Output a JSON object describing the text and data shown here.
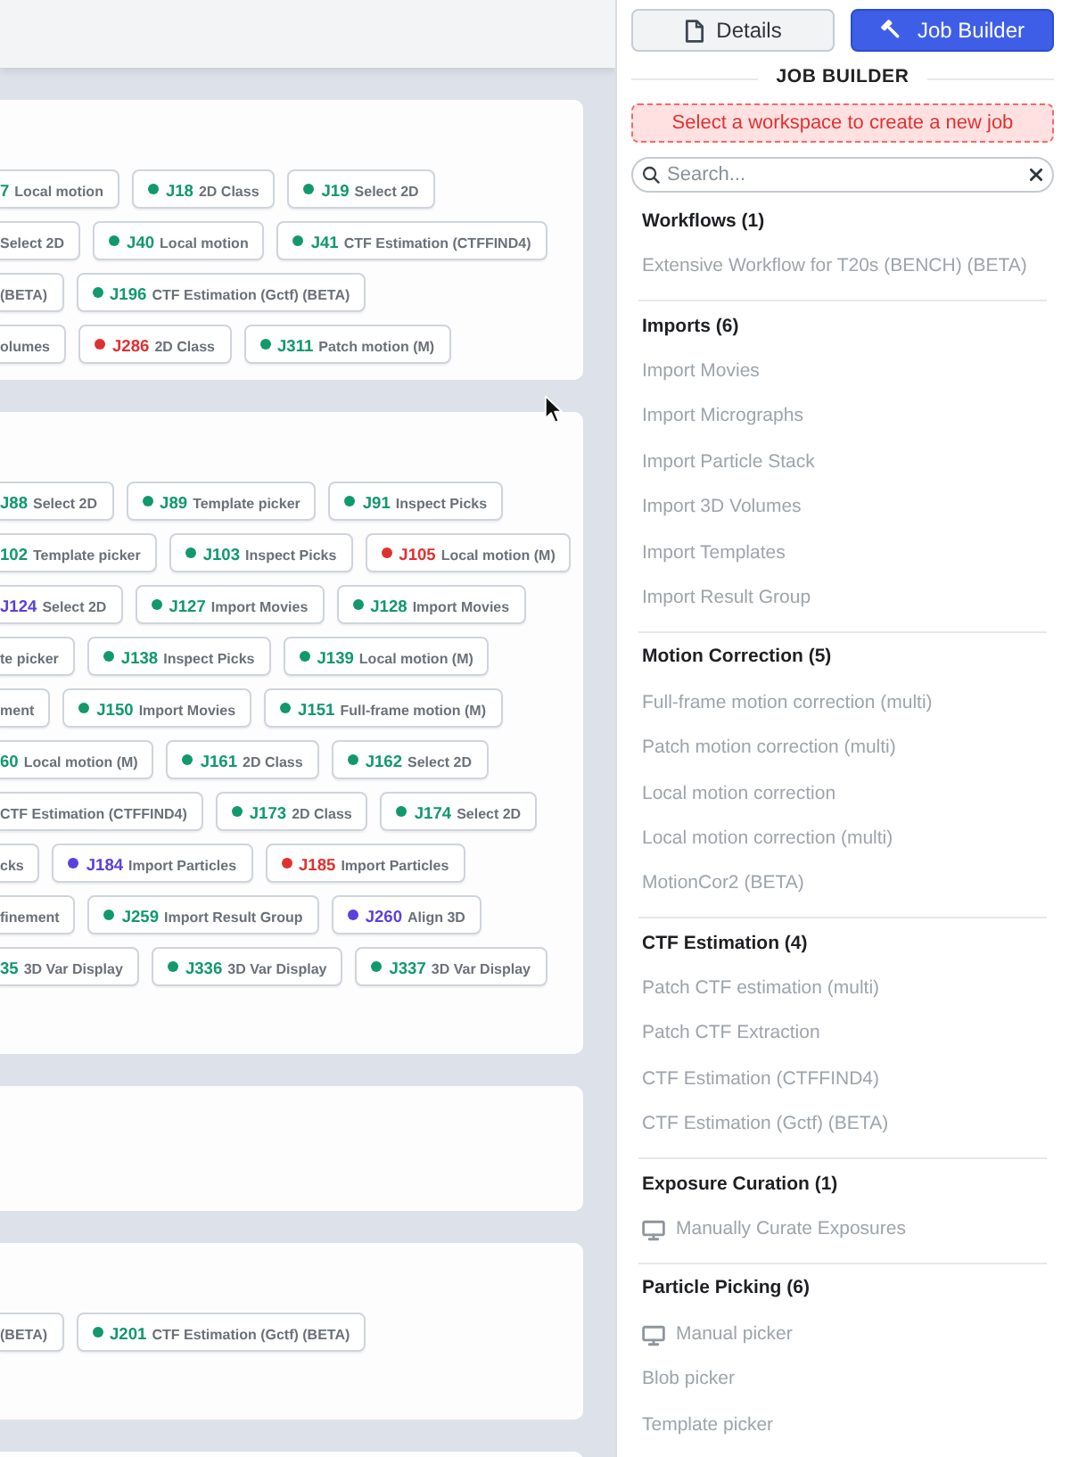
{
  "workspace_cards": [
    {
      "kind": "jobs",
      "rows": [
        [
          {
            "kind": "clipped",
            "job": "7",
            "title": "Local motion",
            "color": "#11996b"
          },
          {
            "kind": "full",
            "job": "J18",
            "title": "2D Class",
            "color": "#11996b"
          },
          {
            "kind": "full",
            "job": "J19",
            "title": "Select 2D",
            "color": "#11996b"
          }
        ],
        [
          {
            "kind": "clipped",
            "title": "Select 2D"
          },
          {
            "kind": "full",
            "job": "J40",
            "title": "Local motion",
            "color": "#11996b"
          },
          {
            "kind": "full",
            "job": "J41",
            "title": "CTF Estimation (CTFFIND4)",
            "color": "#11996b"
          }
        ],
        [
          {
            "kind": "clipped",
            "title": "(BETA)"
          },
          {
            "kind": "full",
            "job": "J196",
            "title": "CTF Estimation (Gctf) (BETA)",
            "color": "#11996b"
          }
        ],
        [
          {
            "kind": "clipped",
            "title": "olumes"
          },
          {
            "kind": "full",
            "job": "J286",
            "title": "2D Class",
            "color": "#e03131"
          },
          {
            "kind": "full",
            "job": "J311",
            "title": "Patch motion (M)",
            "color": "#11996b"
          }
        ]
      ]
    },
    {
      "kind": "jobs",
      "rows": [
        [
          {
            "kind": "clipped",
            "job": "J88",
            "title": "Select 2D",
            "color": "#11996b"
          },
          {
            "kind": "full",
            "job": "J89",
            "title": "Template picker",
            "color": "#11996b"
          },
          {
            "kind": "full",
            "job": "J91",
            "title": "Inspect Picks",
            "color": "#11996b"
          }
        ],
        [
          {
            "kind": "clipped",
            "job": "102",
            "title": "Template picker",
            "color": "#11996b"
          },
          {
            "kind": "full",
            "job": "J103",
            "title": "Inspect Picks",
            "color": "#11996b"
          },
          {
            "kind": "full",
            "job": "J105",
            "title": "Local motion (M)",
            "color": "#e03131"
          }
        ],
        [
          {
            "kind": "clipped",
            "job": "J124",
            "title": "Select 2D",
            "color": "#5b3fe0"
          },
          {
            "kind": "full",
            "job": "J127",
            "title": "Import Movies",
            "color": "#11996b"
          },
          {
            "kind": "full",
            "job": "J128",
            "title": "Import Movies",
            "color": "#11996b"
          }
        ],
        [
          {
            "kind": "clipped",
            "title": "te picker"
          },
          {
            "kind": "full",
            "job": "J138",
            "title": "Inspect Picks",
            "color": "#11996b"
          },
          {
            "kind": "full",
            "job": "J139",
            "title": "Local motion (M)",
            "color": "#11996b"
          }
        ],
        [
          {
            "kind": "clipped",
            "title": "ment"
          },
          {
            "kind": "full",
            "job": "J150",
            "title": "Import Movies",
            "color": "#11996b"
          },
          {
            "kind": "full",
            "job": "J151",
            "title": "Full-frame motion (M)",
            "color": "#11996b"
          }
        ],
        [
          {
            "kind": "clipped",
            "job": "60",
            "title": "Local motion (M)",
            "color": "#11996b"
          },
          {
            "kind": "full",
            "job": "J161",
            "title": "2D Class",
            "color": "#11996b"
          },
          {
            "kind": "full",
            "job": "J162",
            "title": "Select 2D",
            "color": "#11996b"
          }
        ],
        [
          {
            "kind": "clipped",
            "title": "CTF Estimation (CTFFIND4)"
          },
          {
            "kind": "full",
            "job": "J173",
            "title": "2D Class",
            "color": "#11996b"
          },
          {
            "kind": "full",
            "job": "J174",
            "title": "Select 2D",
            "color": "#11996b"
          }
        ],
        [
          {
            "kind": "clipped",
            "title": "cks"
          },
          {
            "kind": "full",
            "job": "J184",
            "title": "Import Particles",
            "color": "#5b3fe0"
          },
          {
            "kind": "full",
            "job": "J185",
            "title": "Import Particles",
            "color": "#e03131"
          }
        ],
        [
          {
            "kind": "clipped",
            "title": "finement"
          },
          {
            "kind": "full",
            "job": "J259",
            "title": "Import Result Group",
            "color": "#11996b"
          },
          {
            "kind": "full",
            "job": "J260",
            "title": "Align 3D",
            "color": "#5b3fe0"
          }
        ],
        [
          {
            "kind": "clipped",
            "job": "35",
            "title": "3D Var Display",
            "color": "#11996b"
          },
          {
            "kind": "full",
            "job": "J336",
            "title": "3D Var Display",
            "color": "#11996b"
          },
          {
            "kind": "full",
            "job": "J337",
            "title": "3D Var Display",
            "color": "#11996b"
          }
        ]
      ]
    },
    {
      "kind": "blank"
    },
    {
      "kind": "jobs",
      "rows": [
        [
          {
            "kind": "clipped",
            "title": "(BETA)"
          },
          {
            "kind": "full",
            "job": "J201",
            "title": "CTF Estimation (Gctf) (BETA)",
            "color": "#11996b"
          }
        ]
      ]
    },
    {
      "kind": "blank"
    }
  ],
  "tabs": [
    {
      "label": "Details",
      "selected": false
    },
    {
      "label": "Job Builder",
      "selected": true
    }
  ],
  "job_builder": {
    "title": "JOB BUILDER",
    "alert": "Select a workspace to create a new job",
    "search": {
      "placeholder": "Search..."
    },
    "categories": [
      {
        "heading": "Workflows (1)",
        "items": [
          {
            "label": "Extensive Workflow for T20s (BENCH) (BETA)",
            "kind": "standard",
            "disabled": true
          }
        ]
      },
      {
        "heading": "Imports (6)",
        "items": [
          {
            "label": "Import Movies",
            "kind": "standard",
            "disabled": true
          },
          {
            "label": "Import Micrographs",
            "kind": "standard",
            "disabled": true
          },
          {
            "label": "Import Particle Stack",
            "kind": "standard",
            "disabled": true
          },
          {
            "label": "Import 3D Volumes",
            "kind": "standard",
            "disabled": true
          },
          {
            "label": "Import Templates",
            "kind": "standard",
            "disabled": true
          },
          {
            "label": "Import Result Group",
            "kind": "standard",
            "disabled": true
          }
        ]
      },
      {
        "heading": "Motion Correction (5)",
        "items": [
          {
            "label": "Full-frame motion correction (multi)",
            "kind": "standard",
            "disabled": true
          },
          {
            "label": "Patch motion correction (multi)",
            "kind": "standard",
            "disabled": true
          },
          {
            "label": "Local motion correction",
            "kind": "standard",
            "disabled": true
          },
          {
            "label": "Local motion correction (multi)",
            "kind": "standard",
            "disabled": true
          },
          {
            "label": "MotionCor2 (BETA)",
            "kind": "standard",
            "disabled": true
          }
        ]
      },
      {
        "heading": "CTF Estimation (4)",
        "items": [
          {
            "label": "Patch CTF estimation (multi)",
            "kind": "standard",
            "disabled": true
          },
          {
            "label": "Patch CTF Extraction",
            "kind": "standard",
            "disabled": true
          },
          {
            "label": "CTF Estimation (CTFFIND4)",
            "kind": "standard",
            "disabled": true
          },
          {
            "label": "CTF Estimation (Gctf) (BETA)",
            "kind": "standard",
            "disabled": true
          }
        ]
      },
      {
        "heading": "Exposure Curation (1)",
        "items": [
          {
            "label": "Manually Curate Exposures",
            "kind": "interactive",
            "disabled": true
          }
        ]
      },
      {
        "heading": "Particle Picking (6)",
        "items": [
          {
            "label": "Manual picker",
            "kind": "interactive",
            "disabled": true
          },
          {
            "label": "Blob picker",
            "kind": "standard",
            "disabled": true
          },
          {
            "label": "Template picker",
            "kind": "standard",
            "disabled": true
          }
        ]
      }
    ]
  }
}
